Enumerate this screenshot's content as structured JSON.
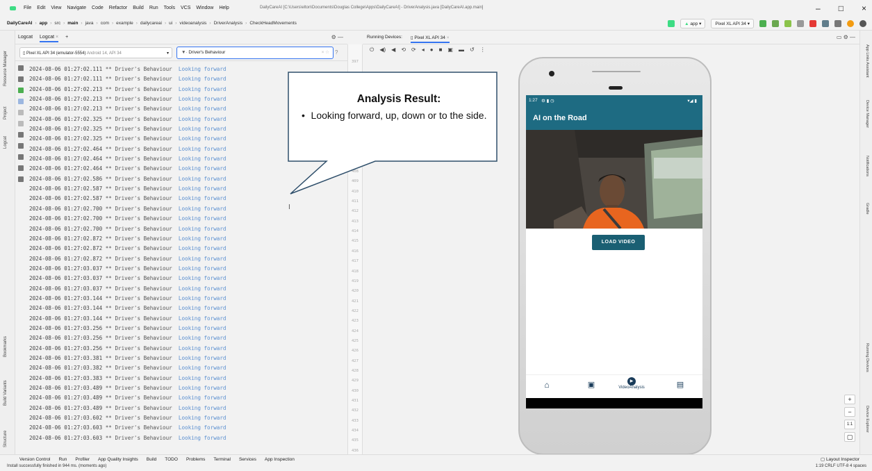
{
  "menubar": {
    "items": [
      "File",
      "Edit",
      "View",
      "Navigate",
      "Code",
      "Refactor",
      "Build",
      "Run",
      "Tools",
      "VCS",
      "Window",
      "Help"
    ],
    "window_title": "DailyCareAI [C:\\Users\\elton\\Documents\\Douglas College\\Apps\\DailyCareAI] - DriverAnalysis.java [DailyCareAI.app.main]"
  },
  "breadcrumb": [
    "DailyCareAI",
    "app",
    "src",
    "main",
    "java",
    "com",
    "example",
    "dailycareai",
    "ui",
    "videoanalysis",
    "DriverAnalysis",
    "CheckHeadMovements"
  ],
  "toolbar": {
    "run_config": "app",
    "device": "Pixel XL API 34"
  },
  "logcat": {
    "tab_label": "Logcat",
    "tab_active": "Logcat",
    "device_name": "Pixel XL API 34 (emulator-5554)",
    "device_info": "Android 14, API 34",
    "filter": "Driver's Behaviour",
    "lines": [
      {
        "ts": "2024-08-06 01:27:02.111",
        "tag": "** Driver's Behaviour",
        "msg": "Looking forward"
      },
      {
        "ts": "2024-08-06 01:27:02.111",
        "tag": "** Driver's Behaviour",
        "msg": "Looking forward"
      },
      {
        "ts": "2024-08-06 01:27:02.213",
        "tag": "** Driver's Behaviour",
        "msg": "Looking forward"
      },
      {
        "ts": "2024-08-06 01:27:02.213",
        "tag": "** Driver's Behaviour",
        "msg": "Looking forward"
      },
      {
        "ts": "2024-08-06 01:27:02.213",
        "tag": "** Driver's Behaviour",
        "msg": "Looking forward"
      },
      {
        "ts": "2024-08-06 01:27:02.325",
        "tag": "** Driver's Behaviour",
        "msg": "Looking forward"
      },
      {
        "ts": "2024-08-06 01:27:02.325",
        "tag": "** Driver's Behaviour",
        "msg": "Looking forward"
      },
      {
        "ts": "2024-08-06 01:27:02.325",
        "tag": "** Driver's Behaviour",
        "msg": "Looking forward"
      },
      {
        "ts": "2024-08-06 01:27:02.464",
        "tag": "** Driver's Behaviour",
        "msg": "Looking forward"
      },
      {
        "ts": "2024-08-06 01:27:02.464",
        "tag": "** Driver's Behaviour",
        "msg": "Looking forward"
      },
      {
        "ts": "2024-08-06 01:27:02.464",
        "tag": "** Driver's Behaviour",
        "msg": "Looking forward"
      },
      {
        "ts": "2024-08-06 01:27:02.586",
        "tag": "** Driver's Behaviour",
        "msg": "Looking forward"
      },
      {
        "ts": "2024-08-06 01:27:02.587",
        "tag": "** Driver's Behaviour",
        "msg": "Looking forward"
      },
      {
        "ts": "2024-08-06 01:27:02.587",
        "tag": "** Driver's Behaviour",
        "msg": "Looking forward"
      },
      {
        "ts": "2024-08-06 01:27:02.700",
        "tag": "** Driver's Behaviour",
        "msg": "Looking forward"
      },
      {
        "ts": "2024-08-06 01:27:02.700",
        "tag": "** Driver's Behaviour",
        "msg": "Looking forward"
      },
      {
        "ts": "2024-08-06 01:27:02.700",
        "tag": "** Driver's Behaviour",
        "msg": "Looking forward"
      },
      {
        "ts": "2024-08-06 01:27:02.872",
        "tag": "** Driver's Behaviour",
        "msg": "Looking forward"
      },
      {
        "ts": "2024-08-06 01:27:02.872",
        "tag": "** Driver's Behaviour",
        "msg": "Looking forward"
      },
      {
        "ts": "2024-08-06 01:27:02.872",
        "tag": "** Driver's Behaviour",
        "msg": "Looking forward"
      },
      {
        "ts": "2024-08-06 01:27:03.037",
        "tag": "** Driver's Behaviour",
        "msg": "Looking forward"
      },
      {
        "ts": "2024-08-06 01:27:03.037",
        "tag": "** Driver's Behaviour",
        "msg": "Looking forward"
      },
      {
        "ts": "2024-08-06 01:27:03.037",
        "tag": "** Driver's Behaviour",
        "msg": "Looking forward"
      },
      {
        "ts": "2024-08-06 01:27:03.144",
        "tag": "** Driver's Behaviour",
        "msg": "Looking forward"
      },
      {
        "ts": "2024-08-06 01:27:03.144",
        "tag": "** Driver's Behaviour",
        "msg": "Looking forward"
      },
      {
        "ts": "2024-08-06 01:27:03.144",
        "tag": "** Driver's Behaviour",
        "msg": "Looking forward"
      },
      {
        "ts": "2024-08-06 01:27:03.256",
        "tag": "** Driver's Behaviour",
        "msg": "Looking forward"
      },
      {
        "ts": "2024-08-06 01:27:03.256",
        "tag": "** Driver's Behaviour",
        "msg": "Looking forward"
      },
      {
        "ts": "2024-08-06 01:27:03.256",
        "tag": "** Driver's Behaviour",
        "msg": "Looking forward"
      },
      {
        "ts": "2024-08-06 01:27:03.381",
        "tag": "** Driver's Behaviour",
        "msg": "Looking forward"
      },
      {
        "ts": "2024-08-06 01:27:03.382",
        "tag": "** Driver's Behaviour",
        "msg": "Looking forward"
      },
      {
        "ts": "2024-08-06 01:27:03.383",
        "tag": "** Driver's Behaviour",
        "msg": "Looking forward"
      },
      {
        "ts": "2024-08-06 01:27:03.489",
        "tag": "** Driver's Behaviour",
        "msg": "Looking forward"
      },
      {
        "ts": "2024-08-06 01:27:03.489",
        "tag": "** Driver's Behaviour",
        "msg": "Looking forward"
      },
      {
        "ts": "2024-08-06 01:27:03.489",
        "tag": "** Driver's Behaviour",
        "msg": "Looking forward"
      },
      {
        "ts": "2024-08-06 01:27:03.602",
        "tag": "** Driver's Behaviour",
        "msg": "Looking forward"
      },
      {
        "ts": "2024-08-06 01:27:03.603",
        "tag": "** Driver's Behaviour",
        "msg": "Looking forward"
      },
      {
        "ts": "2024-08-06 01:27:03.603",
        "tag": "** Driver's Behaviour",
        "msg": "Looking forward"
      }
    ]
  },
  "gutter_numbers": [
    "397",
    "408",
    "409",
    "410",
    "411",
    "412",
    "413",
    "414",
    "415",
    "416",
    "417",
    "418",
    "419",
    "420",
    "421",
    "422",
    "423",
    "424",
    "425",
    "426",
    "427",
    "428",
    "429",
    "430",
    "431",
    "432",
    "433",
    "434",
    "435",
    "436"
  ],
  "running_devices": {
    "label": "Running Devices:",
    "tab": "Pixel XL API 34"
  },
  "emulator": {
    "status_time": "1:27",
    "app_title": "AI on the Road",
    "load_button": "LOAD VIDEO",
    "nav_items": [
      {
        "icon": "home-icon",
        "label": ""
      },
      {
        "icon": "video-icon",
        "label": ""
      },
      {
        "icon": "play-circle-icon",
        "label": "VideoAnalysis"
      },
      {
        "icon": "gallery-icon",
        "label": ""
      }
    ]
  },
  "callout": {
    "title": "Analysis Result:",
    "body": "Looking forward, up, down or to the side."
  },
  "bottom_tools": [
    "Version Control",
    "Run",
    "Profiler",
    "App Quality Insights",
    "Build",
    "TODO",
    "Problems",
    "Terminal",
    "Services",
    "App Inspection"
  ],
  "layout_inspector": "Layout Inspector",
  "status": {
    "message": "Install successfully finished in 944 ms. (moments ago)",
    "right": "1:19  CRLF  UTF-8  4 spaces"
  },
  "left_panels": [
    "Resource Manager",
    "Project",
    "Logcat",
    "Bookmarks",
    "Build Variants",
    "Structure"
  ],
  "right_panels": [
    "App Links Assistant",
    "Device Manager",
    "Notifications",
    "Gradle",
    "Running Devices",
    "Device Explorer"
  ],
  "colors": {
    "app_bar": "#1e6b82",
    "button": "#1a5f73",
    "accent": "#3574f0",
    "log_message": "#5a8fd0"
  }
}
